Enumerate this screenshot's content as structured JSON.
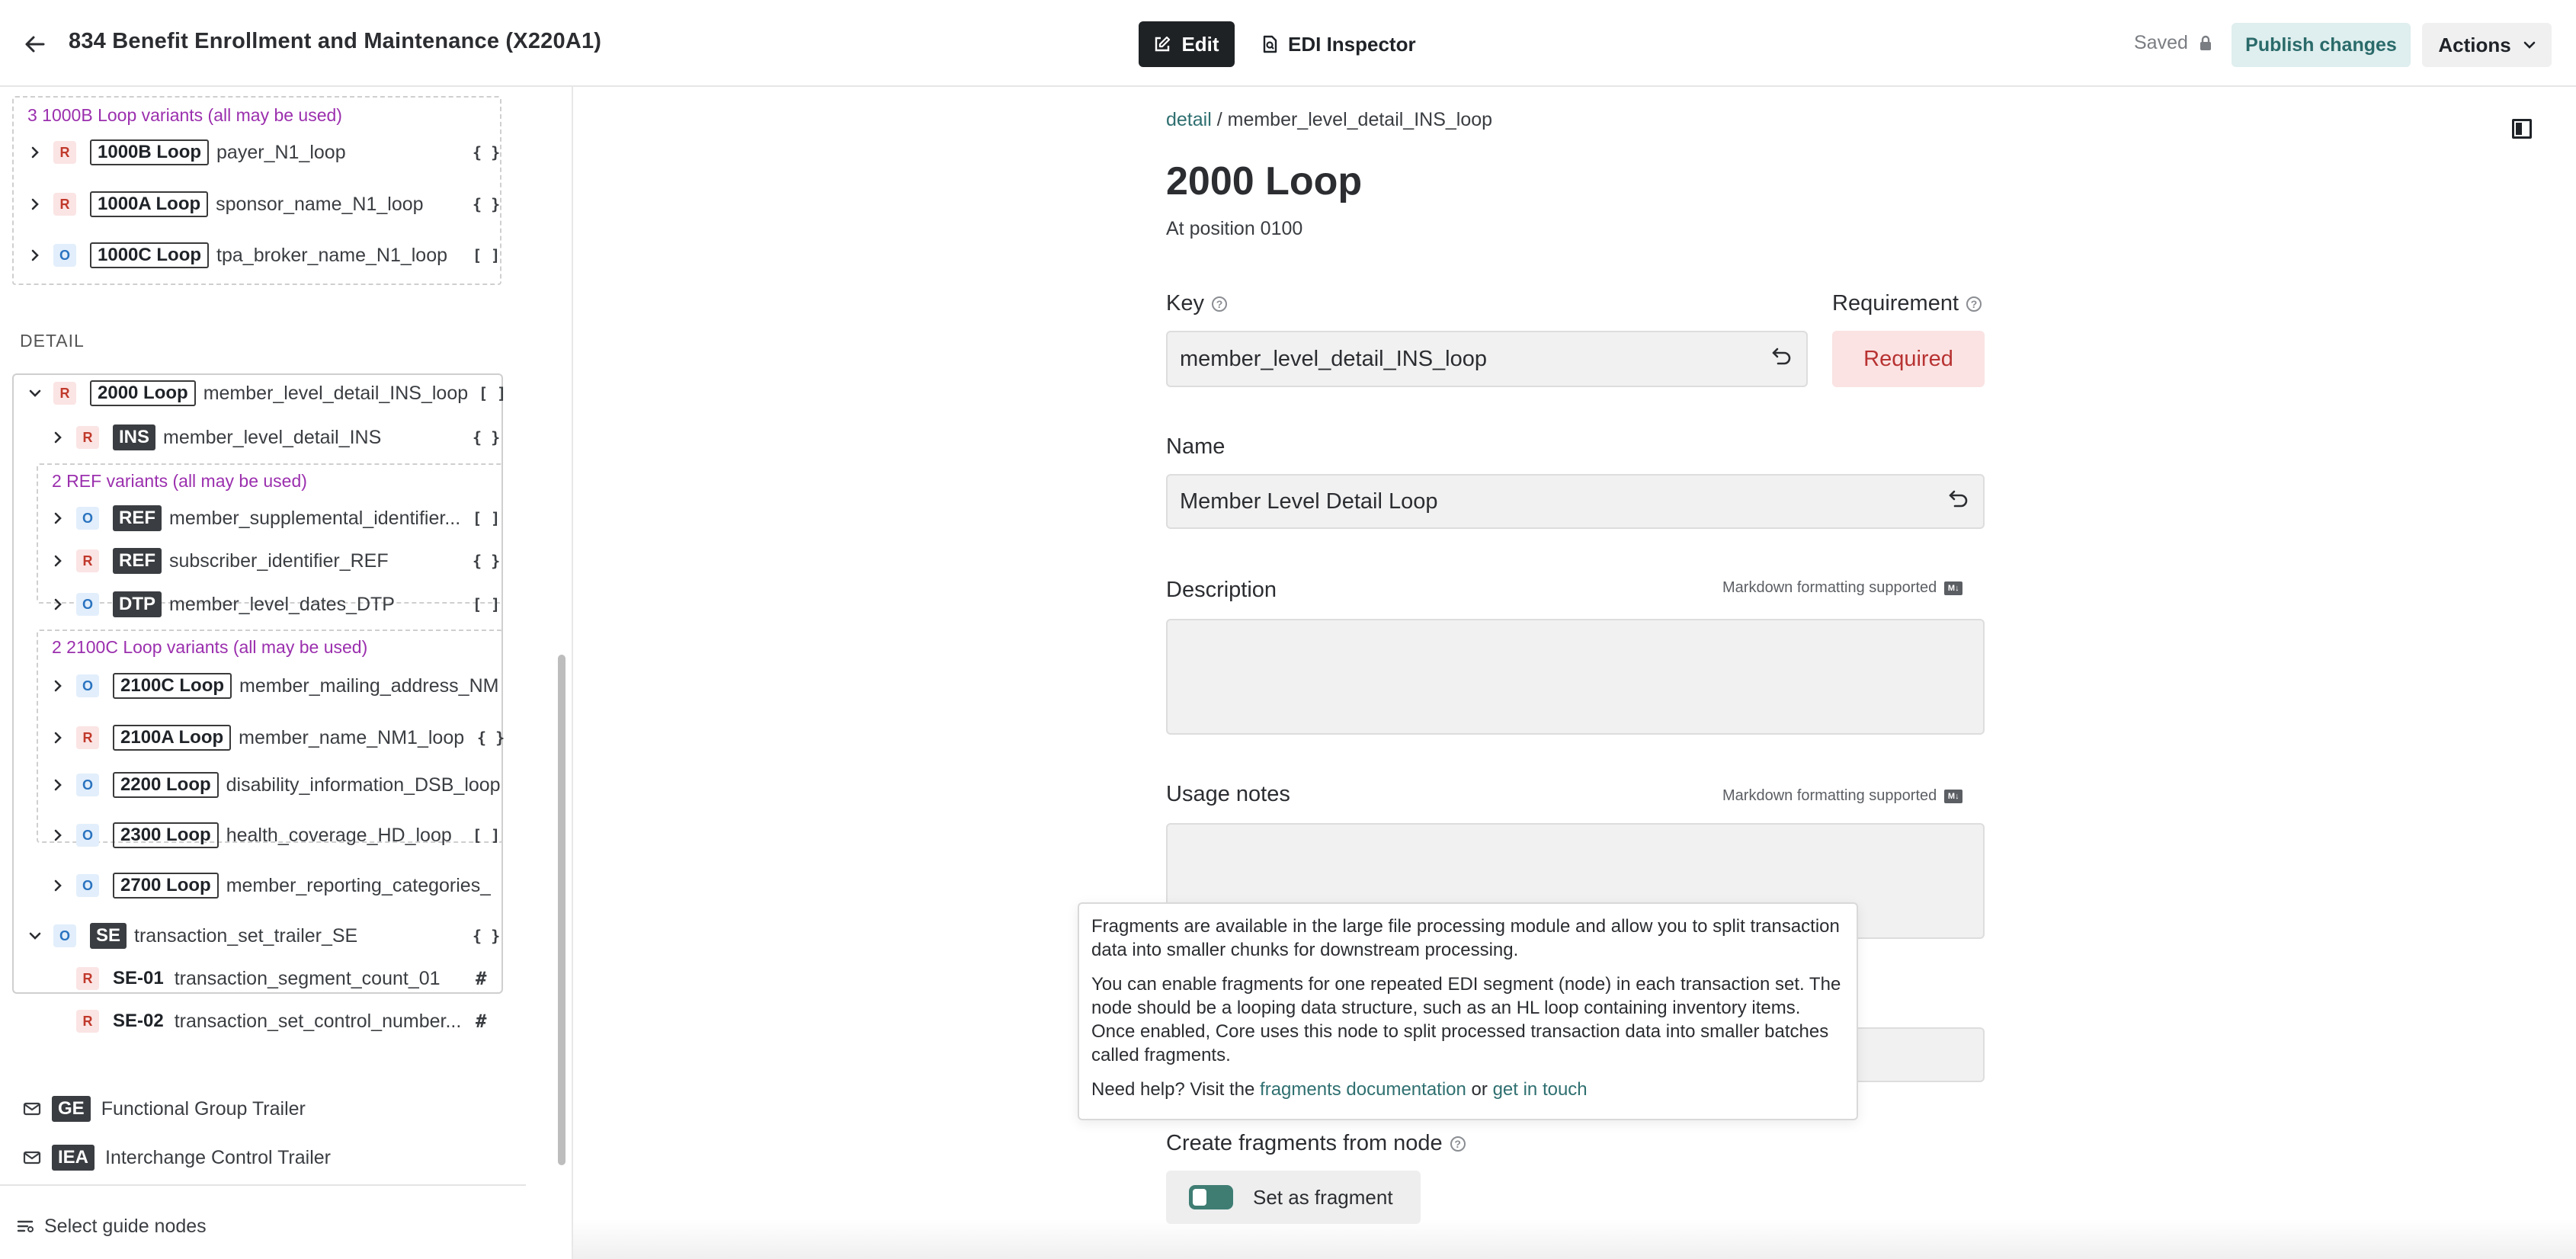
{
  "header": {
    "title": "834 Benefit Enrollment and Maintenance (X220A1)",
    "edit_label": "Edit",
    "inspector_label": "EDI Inspector",
    "saved_label": "Saved",
    "publish_label": "Publish changes",
    "actions_label": "Actions"
  },
  "sidebar": {
    "header_variants_label": "3 1000B Loop variants (all may be used)",
    "header_loops": [
      {
        "req": "R",
        "tag": "1000B Loop",
        "name": "payer_N1_loop",
        "sym": "{ }"
      },
      {
        "req": "R",
        "tag": "1000A Loop",
        "name": "sponsor_name_N1_loop",
        "sym": "{ }"
      },
      {
        "req": "O",
        "tag": "1000C Loop",
        "name": "tpa_broker_name_N1_loop",
        "sym": "[ ]"
      }
    ],
    "detail_title": "DETAIL",
    "loop2000": {
      "req": "R",
      "tag": "2000 Loop",
      "name": "member_level_detail_INS_loop",
      "sym": "[ ]"
    },
    "ins": {
      "req": "R",
      "tag": "INS",
      "name": "member_level_detail_INS",
      "sym": "{ }"
    },
    "ref_variants_label": "2 REF variants (all may be used)",
    "refs": [
      {
        "req": "O",
        "tag": "REF",
        "name": "member_supplemental_identifier...",
        "sym": "[ ]"
      },
      {
        "req": "R",
        "tag": "REF",
        "name": "subscriber_identifier_REF",
        "sym": "{ }"
      }
    ],
    "dtp": {
      "req": "O",
      "tag": "DTP",
      "name": "member_level_dates_DTP",
      "sym": "[ ]"
    },
    "loop2100_variants_label": "2 2100C Loop variants (all may be used)",
    "loops2100": [
      {
        "req": "O",
        "tag": "2100C Loop",
        "name": "member_mailing_address_NM"
      },
      {
        "req": "R",
        "tag": "2100A Loop",
        "name": "member_name_NM1_loop",
        "sym": "{ }"
      }
    ],
    "other_loops": [
      {
        "req": "O",
        "tag": "2200 Loop",
        "name": "disability_information_DSB_loop"
      },
      {
        "req": "O",
        "tag": "2300 Loop",
        "name": "health_coverage_HD_loop",
        "sym": "[ ]"
      },
      {
        "req": "O",
        "tag": "2700 Loop",
        "name": "member_reporting_categories_"
      }
    ],
    "se": {
      "req": "O",
      "tag": "SE",
      "name": "transaction_set_trailer_SE",
      "sym": "{ }"
    },
    "se_elements": [
      {
        "req": "R",
        "code": "SE-01",
        "name": "transaction_segment_count_01",
        "sym": "#"
      },
      {
        "req": "R",
        "code": "SE-02",
        "name": "transaction_set_control_number...",
        "sym": "#"
      }
    ],
    "ge": {
      "tag": "GE",
      "name": "Functional Group Trailer"
    },
    "iea": {
      "tag": "IEA",
      "name": "Interchange Control Trailer"
    },
    "select_nodes_label": "Select guide nodes"
  },
  "main": {
    "breadcrumb_link": "detail",
    "breadcrumb_sep": "/",
    "breadcrumb_current": "member_level_detail_INS_loop",
    "title": "2000 Loop",
    "position": "At position 0100",
    "key_label": "Key",
    "key_value": "member_level_detail_INS_loop",
    "requirement_label": "Requirement",
    "requirement_value": "Required",
    "name_label": "Name",
    "name_value": "Member Level Detail Loop",
    "description_label": "Description",
    "markdown_hint": "Markdown formatting supported",
    "usage_label": "Usage notes",
    "fragments_label": "Create fragments from node",
    "toggle_label": "Set as fragment"
  },
  "tooltip": {
    "p1": "Fragments are available in the large file processing module and allow you to split transaction data into smaller chunks for downstream processing.",
    "p2": "You can enable fragments for one repeated EDI segment (node) in each transaction set. The node should be a looping data structure, such as an HL loop containing inventory items. Once enabled, Core uses this node to split processed transaction data into smaller batches called fragments.",
    "p3_prefix": "Need help? Visit the ",
    "p3_link1": "fragments documentation",
    "p3_mid": " or ",
    "p3_link2": "get in touch"
  },
  "colors": {
    "accent": "#2f6f70",
    "variant_label": "#9b2fae",
    "required_bg": "#fbe3e3",
    "required_text": "#b83232",
    "optional_text": "#2a73c0"
  }
}
